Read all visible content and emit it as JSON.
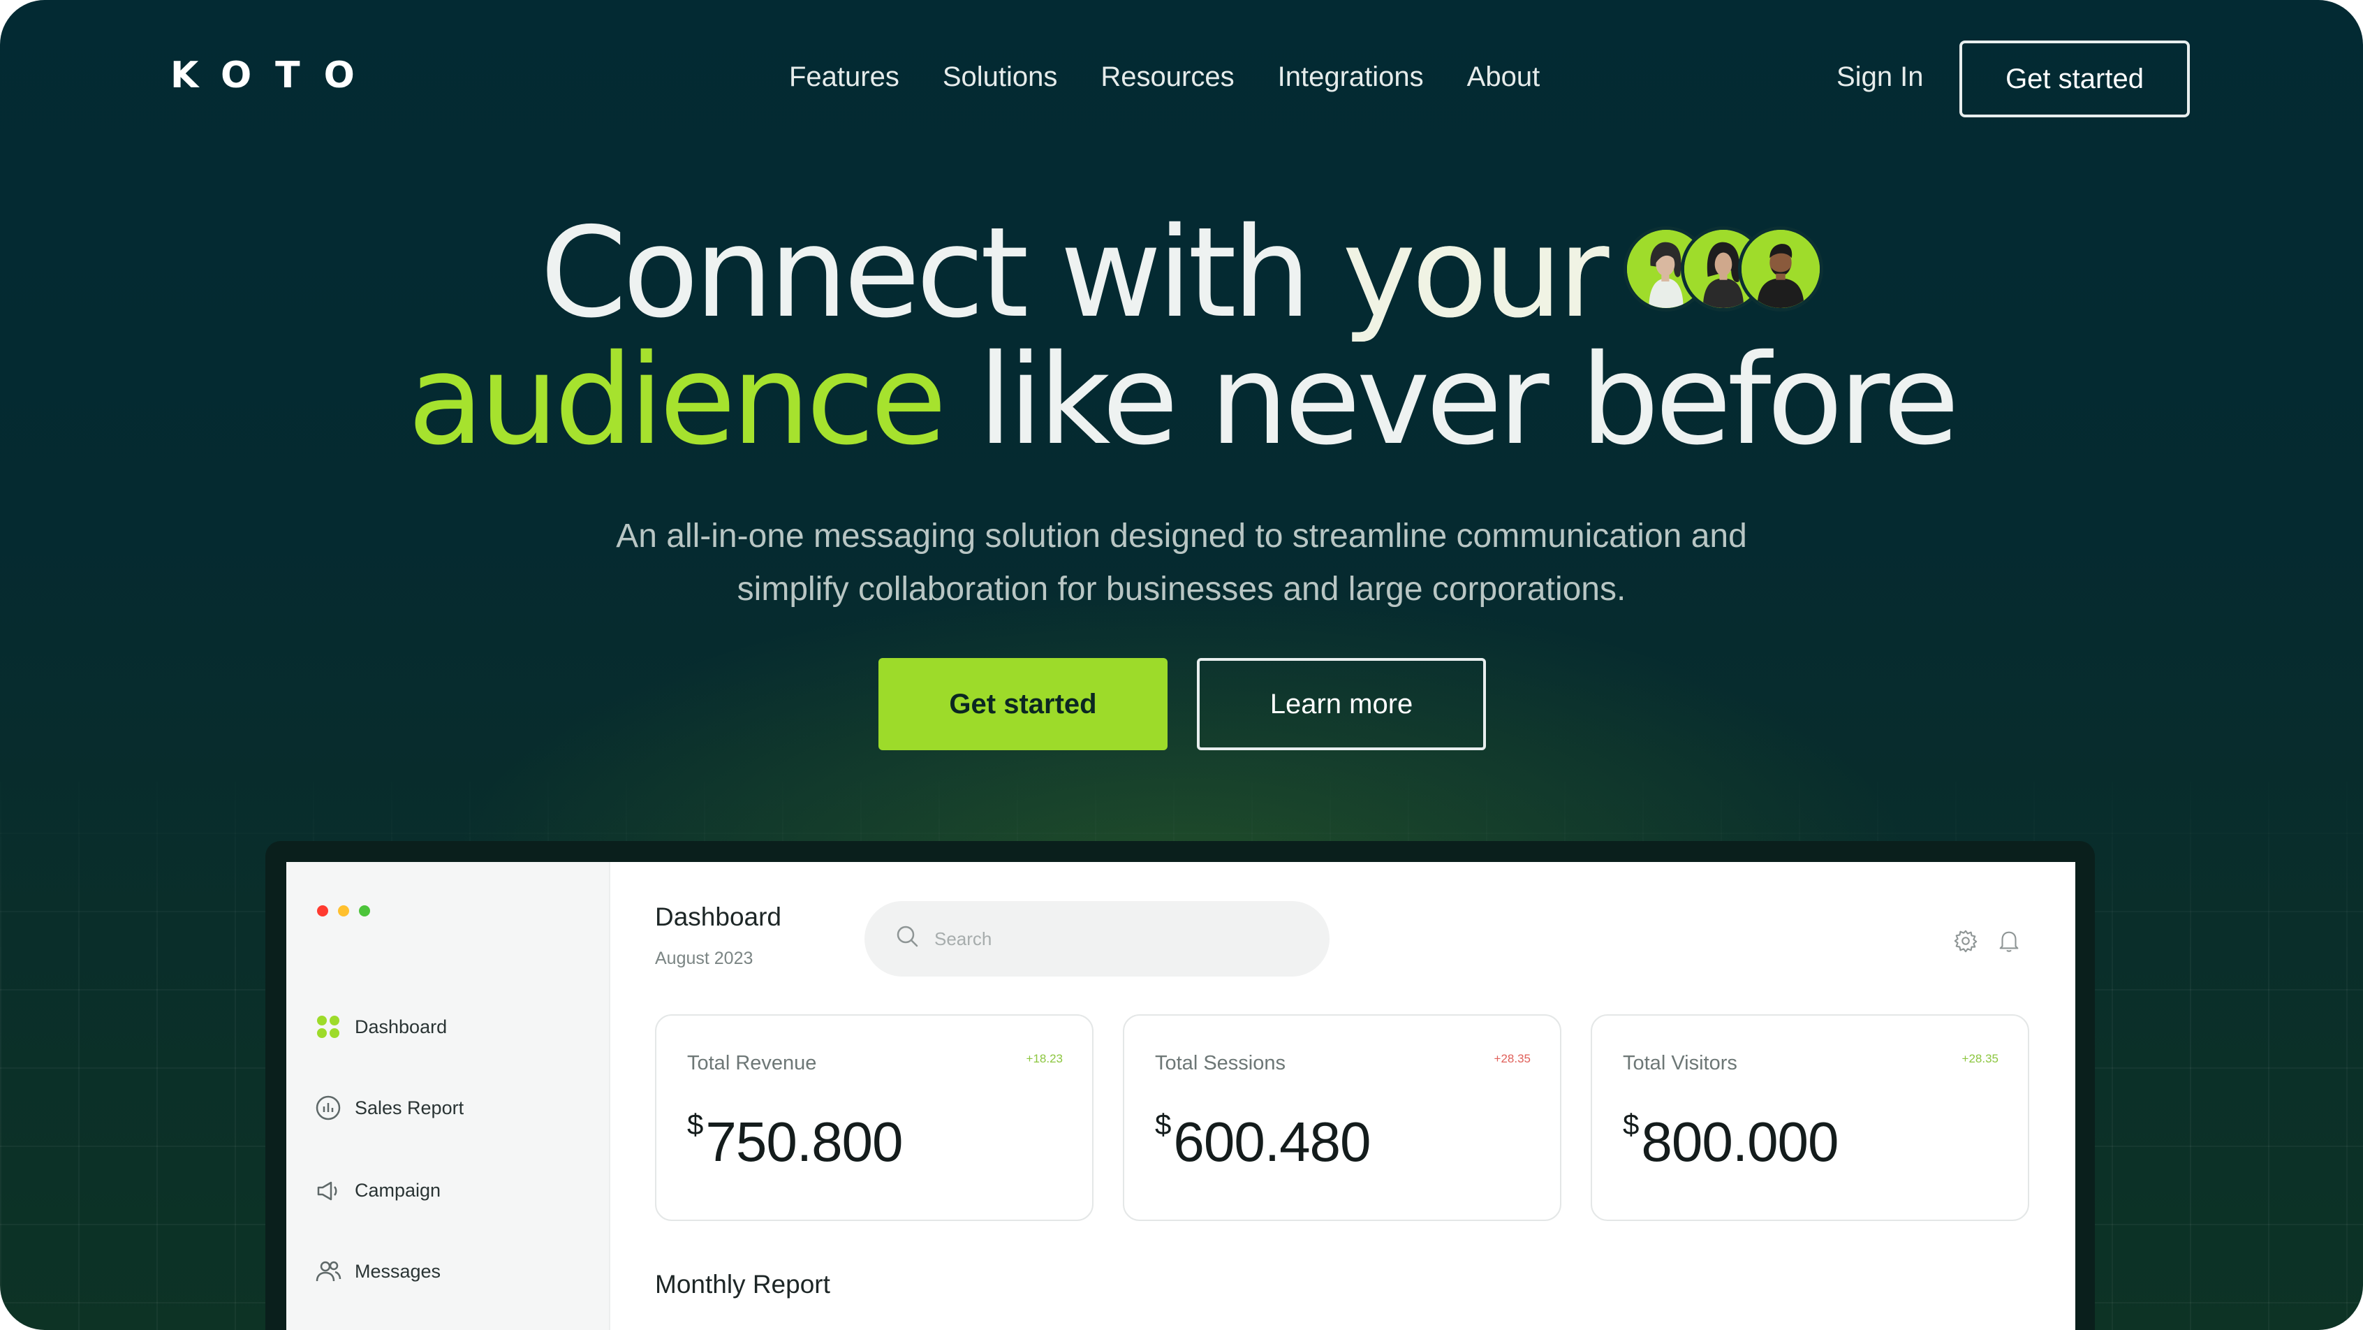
{
  "nav": {
    "logo": "KOTO",
    "links": [
      "Features",
      "Solutions",
      "Resources",
      "Integrations",
      "About"
    ],
    "sign_in": "Sign In",
    "cta": "Get started"
  },
  "hero": {
    "headline_part1": "Connect with ",
    "headline_your": "your",
    "headline_audience": "audience",
    "headline_part2": " like never before",
    "subtitle_line1": "An all-in-one messaging solution designed to streamline communication and",
    "subtitle_line2": "simplify collaboration for businesses and large corporations.",
    "primary_button": "Get started",
    "secondary_button": "Learn more"
  },
  "dashboard": {
    "title": "Dashboard",
    "date": "August 2023",
    "search_placeholder": "Search",
    "sidebar": [
      {
        "label": "Dashboard",
        "icon": "grid-icon"
      },
      {
        "label": "Sales Report",
        "icon": "chart-icon"
      },
      {
        "label": "Campaign",
        "icon": "megaphone-icon"
      },
      {
        "label": "Messages",
        "icon": "users-icon"
      }
    ],
    "cards": [
      {
        "label": "Total Revenue",
        "delta": "+18.23",
        "currency": "$",
        "value": "750.800"
      },
      {
        "label": "Total Sessions",
        "delta": "+28.35",
        "currency": "$",
        "value": "600.480"
      },
      {
        "label": "Total Visitors",
        "delta": "+28.35",
        "currency": "$",
        "value": "800.000"
      }
    ],
    "section_title": "Monthly Report"
  },
  "colors": {
    "background": "#032a33",
    "accent_green": "#9ddb2a",
    "delta_green": "#8cc63f",
    "delta_red": "#e0605a",
    "window_dot_red": "#ff3b30",
    "window_dot_yellow": "#ffc02e",
    "window_dot_green": "#4cc43a"
  }
}
